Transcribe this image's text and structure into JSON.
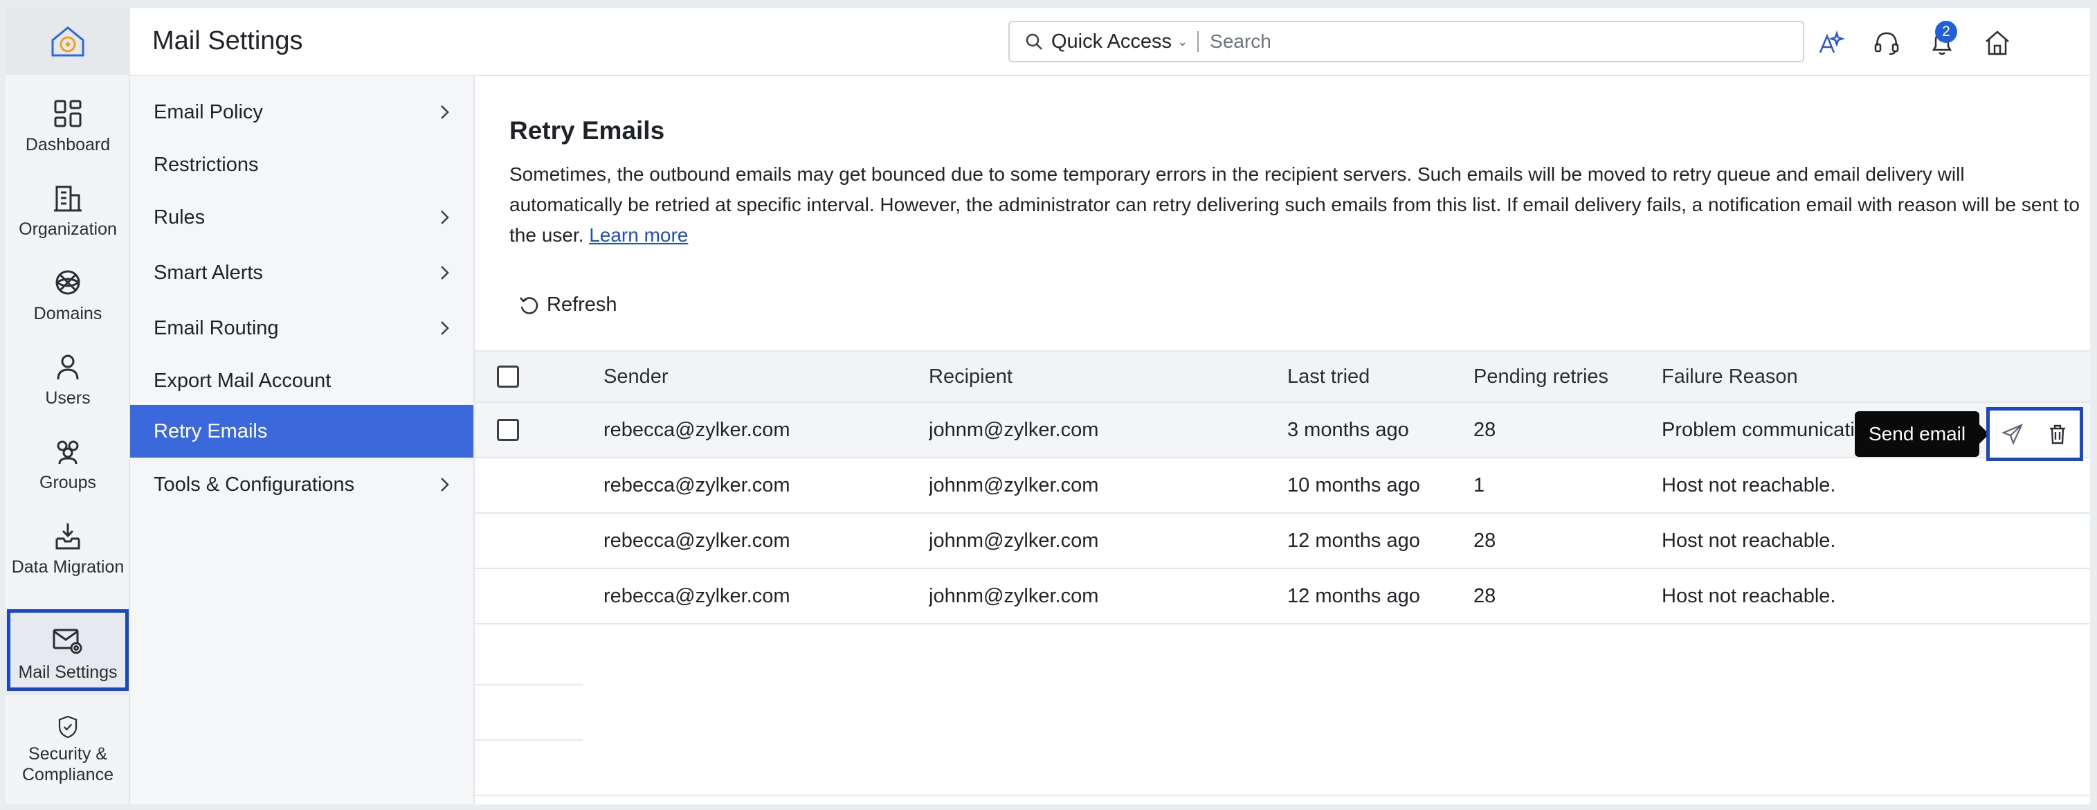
{
  "header": {
    "title": "Mail Settings",
    "search": {
      "quick_access_label": "Quick Access",
      "placeholder": "Search"
    },
    "notification_count": "2",
    "icons": [
      "sparkle-icon",
      "headset-icon",
      "bell-icon",
      "home-icon"
    ]
  },
  "rail": {
    "items": [
      {
        "label": "Dashboard",
        "icon": "dashboard-icon"
      },
      {
        "label": "Organization",
        "icon": "building-icon"
      },
      {
        "label": "Domains",
        "icon": "globe-icon"
      },
      {
        "label": "Users",
        "icon": "user-icon"
      },
      {
        "label": "Groups",
        "icon": "groups-icon"
      },
      {
        "label": "Data Migration",
        "icon": "inbox-download-icon"
      },
      {
        "label": "Mail Settings",
        "icon": "mail-settings-icon",
        "active": true
      },
      {
        "label": "Security & Compliance",
        "icon": "shield-check-icon"
      }
    ]
  },
  "menu": {
    "items": [
      {
        "label": "Email Policy",
        "has_children": true
      },
      {
        "label": "Restrictions",
        "has_children": false
      },
      {
        "label": "Rules",
        "has_children": true
      },
      {
        "label": "Smart Alerts",
        "has_children": true
      },
      {
        "label": "Email Routing",
        "has_children": true
      },
      {
        "label": "Export Mail Account",
        "has_children": false
      },
      {
        "label": "Retry Emails",
        "has_children": false,
        "active": true
      },
      {
        "label": "Tools & Configurations",
        "has_children": true
      }
    ]
  },
  "content": {
    "title": "Retry Emails",
    "description": "Sometimes, the outbound emails may get bounced due to some temporary errors in the recipient servers. Such emails will be moved to retry queue and email delivery will automatically be retried at specific interval. However, the administrator can retry delivering such emails from this list. If email delivery fails, a notification email with reason will be sent to the user.",
    "learn_more": "Learn more",
    "refresh_label": "Refresh",
    "table": {
      "columns": [
        "Sender",
        "Recipient",
        "Last tried",
        "Pending retries",
        "Failure Reason"
      ],
      "rows": [
        {
          "sender": "rebecca@zylker.com",
          "recipient": "johnm@zylker.com",
          "last_tried": "3 months ago",
          "pending": "28",
          "reason": "Problem communicating"
        },
        {
          "sender": "rebecca@zylker.com",
          "recipient": "johnm@zylker.com",
          "last_tried": "10 months ago",
          "pending": "1",
          "reason": "Host not reachable."
        },
        {
          "sender": "rebecca@zylker.com",
          "recipient": "johnm@zylker.com",
          "last_tried": "12 months ago",
          "pending": "28",
          "reason": "Host not reachable."
        },
        {
          "sender": "rebecca@zylker.com",
          "recipient": "johnm@zylker.com",
          "last_tried": "12 months ago",
          "pending": "28",
          "reason": "Host not reachable."
        }
      ]
    },
    "tooltip": "Send email"
  },
  "colors": {
    "accent": "#3b69dc",
    "highlight_border": "#1a47c2",
    "badge": "#2160d8"
  }
}
